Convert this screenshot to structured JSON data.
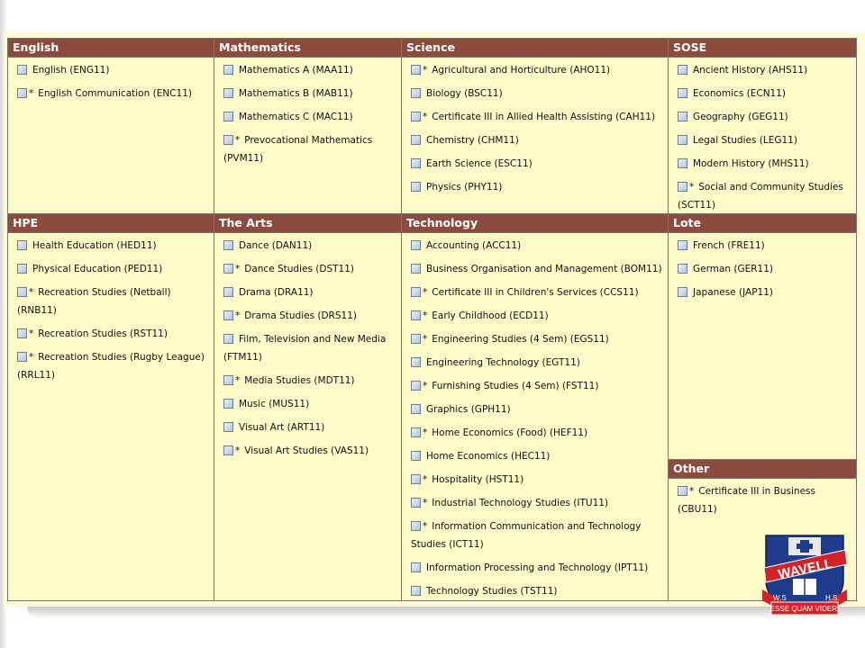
{
  "colors": {
    "header_bg": "#8b4b3d",
    "panel_bg": "#fffbc9",
    "border": "#777777",
    "logo_shield": "#1f3b8c",
    "logo_banner": "#d2232a"
  },
  "categories": [
    {
      "title": "English",
      "items": [
        {
          "label": "English (ENG11)",
          "star": false
        },
        {
          "label": "English Communication (ENC11)",
          "star": true
        }
      ]
    },
    {
      "title": "Mathematics",
      "items": [
        {
          "label": "Mathematics A (MAA11)",
          "star": false
        },
        {
          "label": "Mathematics B (MAB11)",
          "star": false
        },
        {
          "label": "Mathematics C (MAC11)",
          "star": false
        },
        {
          "label": "Prevocational Mathematics (PVM11)",
          "star": true
        }
      ]
    },
    {
      "title": "Science",
      "items": [
        {
          "label": "Agricultural and Horticulture (AHO11)",
          "star": true
        },
        {
          "label": "Biology (BSC11)",
          "star": false
        },
        {
          "label": "Certificate III in Allied Health Assisting (CAH11)",
          "star": true
        },
        {
          "label": "Chemistry (CHM11)",
          "star": false
        },
        {
          "label": "Earth Science (ESC11)",
          "star": false
        },
        {
          "label": "Physics (PHY11)",
          "star": false
        }
      ]
    },
    {
      "title": "SOSE",
      "items": [
        {
          "label": "Ancient History (AHS11)",
          "star": false
        },
        {
          "label": "Economics (ECN11)",
          "star": false
        },
        {
          "label": "Geography (GEG11)",
          "star": false
        },
        {
          "label": "Legal Studies (LEG11)",
          "star": false
        },
        {
          "label": "Modern History (MHS11)",
          "star": false
        },
        {
          "label": "Social and Community Studies (SCT11)",
          "star": true
        }
      ]
    },
    {
      "title": "HPE",
      "items": [
        {
          "label": "Health Education (HED11)",
          "star": false
        },
        {
          "label": "Physical Education (PED11)",
          "star": false
        },
        {
          "label": "Recreation Studies (Netball) (RNB11)",
          "star": true
        },
        {
          "label": "Recreation Studies (RST11)",
          "star": true
        },
        {
          "label": "Recreation Studies (Rugby League) (RRL11)",
          "star": true
        }
      ]
    },
    {
      "title": "The Arts",
      "items": [
        {
          "label": "Dance (DAN11)",
          "star": false
        },
        {
          "label": "Dance Studies (DST11)",
          "star": true
        },
        {
          "label": "Drama (DRA11)",
          "star": false
        },
        {
          "label": "Drama Studies (DRS11)",
          "star": true
        },
        {
          "label": "Film, Television and New Media (FTM11)",
          "star": false
        },
        {
          "label": "Media Studies (MDT11)",
          "star": true
        },
        {
          "label": "Music (MUS11)",
          "star": false
        },
        {
          "label": "Visual Art (ART11)",
          "star": false
        },
        {
          "label": "Visual Art Studies (VAS11)",
          "star": true
        }
      ]
    },
    {
      "title": "Technology",
      "items": [
        {
          "label": "Accounting (ACC11)",
          "star": false
        },
        {
          "label": "Business Organisation and Management (BOM11)",
          "star": false
        },
        {
          "label": "Certificate III in Children's Services (CCS11)",
          "star": true
        },
        {
          "label": "Early Childhood (ECD11)",
          "star": true
        },
        {
          "label": "Engineering Studies (4 Sem) (EGS11)",
          "star": true
        },
        {
          "label": "Engineering Technology (EGT11)",
          "star": false
        },
        {
          "label": "Furnishing Studies (4 Sem) (FST11)",
          "star": true
        },
        {
          "label": "Graphics (GPH11)",
          "star": false
        },
        {
          "label": "Home Economics (Food) (HEF11)",
          "star": true
        },
        {
          "label": "Home Economics (HEC11)",
          "star": false
        },
        {
          "label": "Hospitality (HST11)",
          "star": true
        },
        {
          "label": "Industrial Technology Studies (ITU11)",
          "star": true
        },
        {
          "label": "Information Communication and Technology Studies (ICT11)",
          "star": true
        },
        {
          "label": "Information Processing and Technology (IPT11)",
          "star": false
        },
        {
          "label": "Technology Studies (TST11)",
          "star": false
        }
      ]
    },
    {
      "title": "Lote",
      "items": [
        {
          "label": "French (FRE11)",
          "star": false
        },
        {
          "label": "German (GER11)",
          "star": false
        },
        {
          "label": "Japanese (JAP11)",
          "star": false
        }
      ]
    },
    {
      "title": "Other",
      "items": [
        {
          "label": "Certificate III in Business (CBU11)",
          "star": true
        }
      ]
    }
  ],
  "logo": {
    "school": "WAVELL",
    "initials_left": "W.S",
    "initials_right": "H.S.",
    "motto": "ESSE QUAM VIDERI"
  }
}
